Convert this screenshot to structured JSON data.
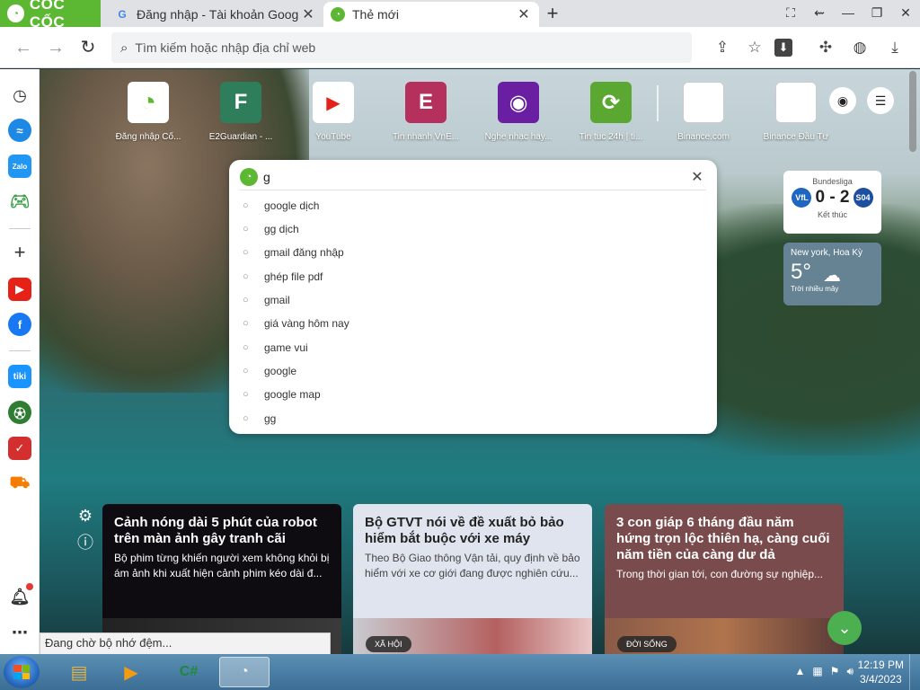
{
  "brand": {
    "name": "CỐC CỐC"
  },
  "tabs": [
    {
      "title": "Đăng nhập - Tài khoản Goog",
      "favicon": "google-icon"
    },
    {
      "title": "Thẻ mới",
      "favicon": "coccoc-icon"
    }
  ],
  "omnibox": {
    "placeholder": "Tìm kiếm hoặc nhập địa chỉ web"
  },
  "speed_dial": [
    {
      "label": "Đăng nhập Cố...",
      "glyph": "◔",
      "color": "#ffffff"
    },
    {
      "label": "E2Guardian - ...",
      "glyph": "F",
      "color": "#2e7d5b"
    },
    {
      "label": "YouTube",
      "glyph": "▶",
      "color": "#ffffff"
    },
    {
      "label": "Tin nhanh VnE...",
      "glyph": "E",
      "color": "#b5305c"
    },
    {
      "label": "Nghe nhạc hay...",
      "glyph": "◉",
      "color": "#6a1fa2"
    },
    {
      "label": "Tin tuc 24h | ti...",
      "glyph": "⟳",
      "color": "#5aa832"
    },
    {
      "label": "Binance.com",
      "glyph": "",
      "color": "#ffffff"
    },
    {
      "label": "Binance Đầu Tư",
      "glyph": "",
      "color": "#ffffff"
    }
  ],
  "search": {
    "query": "g",
    "suggestions": [
      "google dịch",
      "gg dịch",
      "gmail đăng nhập",
      "ghép file pdf",
      "gmail",
      "giá vàng hôm nay",
      "game vui",
      "google",
      "google map",
      "gg"
    ]
  },
  "score_widget": {
    "league": "Bundesliga",
    "home": 0,
    "away": 2,
    "score_text": "0 - 2",
    "status": "Kết thúc"
  },
  "weather_widget": {
    "location": "New york, Hoa Kỳ",
    "temp": "5°",
    "condition": "Trời nhiều mây"
  },
  "news": [
    {
      "headline": "Cảnh nóng dài 5 phút của robot trên màn ảnh gây tranh cãi",
      "desc": "Bộ phim từng khiến người xem không khỏi bị ám ảnh khi xuất hiện cảnh phim kéo dài đ...",
      "tag": ""
    },
    {
      "headline": "Bộ GTVT nói về đề xuất bỏ bảo hiểm bắt buộc với xe máy",
      "desc": "Theo Bộ Giao thông Vận tải, quy định về bảo hiểm với xe cơ giới đang được nghiên cứu...",
      "tag": "XÃ HỘI"
    },
    {
      "headline": "3 con giáp 6 tháng đầu năm hứng trọn lộc thiên hạ, càng cuối năm tiền của càng dư dả",
      "desc": "Trong thời gian tới, con đường sự nghiệp...",
      "tag": "ĐỜI SỐNG"
    }
  ],
  "status_bar": "Đang chờ bộ nhớ đệm...",
  "clock": {
    "time": "12:19 PM",
    "date": "3/4/2023"
  }
}
